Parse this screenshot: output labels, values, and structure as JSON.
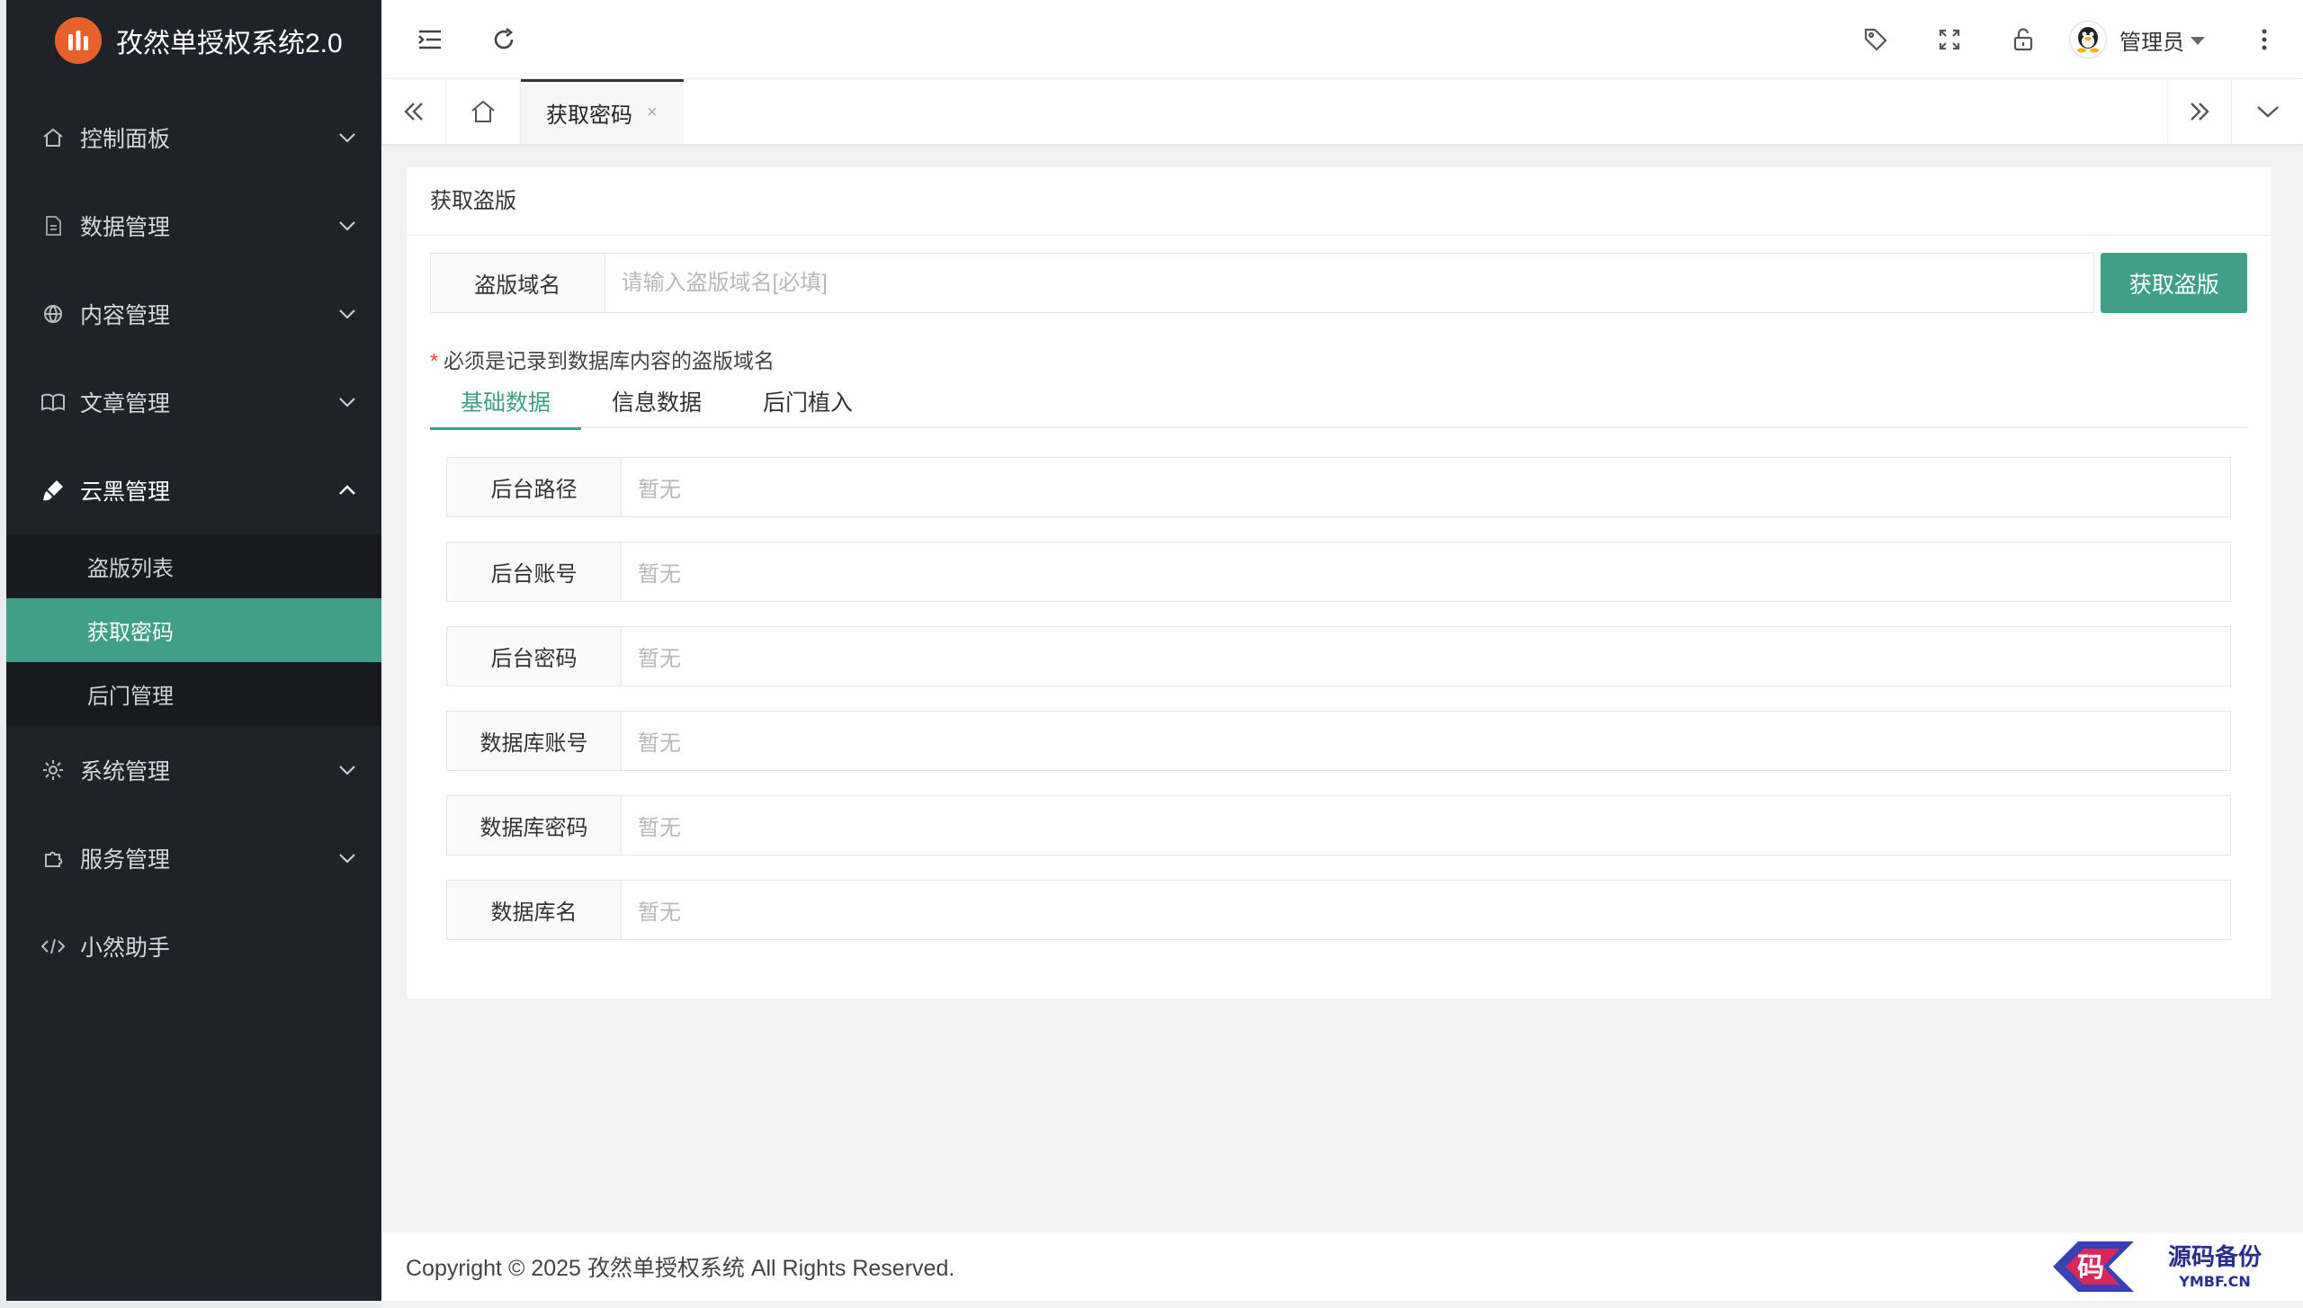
{
  "app": {
    "title": "孜然单授权系统2.0"
  },
  "sidebar": {
    "items": [
      {
        "label": "控制面板",
        "icon": "home-icon"
      },
      {
        "label": "数据管理",
        "icon": "document-icon"
      },
      {
        "label": "内容管理",
        "icon": "globe-icon"
      },
      {
        "label": "文章管理",
        "icon": "book-icon"
      },
      {
        "label": "云黑管理",
        "icon": "brush-icon"
      },
      {
        "label": "系统管理",
        "icon": "gear-icon"
      },
      {
        "label": "服务管理",
        "icon": "puzzle-icon"
      },
      {
        "label": "小然助手",
        "icon": "code-icon"
      }
    ],
    "subitems": [
      {
        "label": "盗版列表"
      },
      {
        "label": "获取密码"
      },
      {
        "label": "后门管理"
      }
    ]
  },
  "header": {
    "user_name": "管理员"
  },
  "tabsbar": {
    "active_tab": "获取密码",
    "close_glyph": "×"
  },
  "card": {
    "title": "获取盗版",
    "domain_label": "盗版域名",
    "domain_placeholder": "请输入盗版域名[必填]",
    "button_label": "获取盗版",
    "note_star": "*",
    "note": "必须是记录到数据库内容的盗版域名",
    "tabs": [
      "基础数据",
      "信息数据",
      "后门植入"
    ],
    "fields": [
      {
        "label": "后台路径",
        "value": "暂无"
      },
      {
        "label": "后台账号",
        "value": "暂无"
      },
      {
        "label": "后台密码",
        "value": "暂无"
      },
      {
        "label": "数据库账号",
        "value": "暂无"
      },
      {
        "label": "数据库密码",
        "value": "暂无"
      },
      {
        "label": "数据库名",
        "value": "暂无"
      }
    ]
  },
  "footer": {
    "copyright": "Copyright © 2025 孜然单授权系统 All Rights Reserved."
  },
  "watermark": {
    "title": "源码备份",
    "sub": "YMBF.CN",
    "glyph": "码"
  },
  "colors": {
    "accent": "#3f9f88",
    "sidebar_bg": "#20222a",
    "logo": "#e8602c"
  }
}
